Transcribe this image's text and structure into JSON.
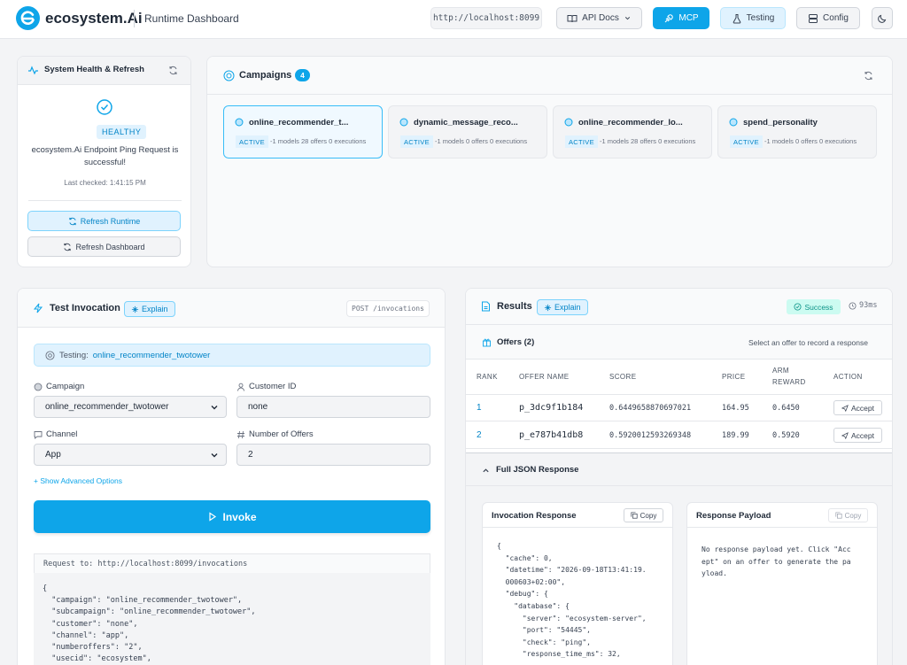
{
  "header": {
    "brand": "ecosystem.Ai",
    "subtitle": "Runtime Dashboard",
    "url": "http://localhost:8099",
    "api_docs": "API Docs",
    "mcp": "MCP",
    "testing": "Testing",
    "config": "Config"
  },
  "health": {
    "title": "System Health & Refresh",
    "status": "HEALTHY",
    "message": "ecosystem.Ai Endpoint Ping Request is successful!",
    "last_checked": "Last checked: 1:41:15 PM",
    "refresh_runtime": "Refresh Runtime",
    "refresh_dashboard": "Refresh Dashboard"
  },
  "campaigns": {
    "title": "Campaigns",
    "count": "4",
    "items": [
      {
        "name": "online_recommender_t...",
        "status": "ACTIVE",
        "meta": "-1 models 28 offers 0 executions"
      },
      {
        "name": "dynamic_message_reco...",
        "status": "ACTIVE",
        "meta": "-1 models 0 offers 0 executions"
      },
      {
        "name": "online_recommender_lo...",
        "status": "ACTIVE",
        "meta": "-1 models 28 offers 0 executions"
      },
      {
        "name": "spend_personality",
        "status": "ACTIVE",
        "meta": "-1 models 0 offers 0 executions"
      }
    ]
  },
  "test_invocation": {
    "title": "Test Invocation",
    "explain": "Explain",
    "endpoint": "POST /invocations",
    "testing_label": "Testing:",
    "testing_value": "online_recommender_twotower",
    "campaign_label": "Campaign",
    "campaign_value": "online_recommender_twotower",
    "customer_label": "Customer ID",
    "customer_value": "none",
    "channel_label": "Channel",
    "channel_value": "App",
    "offers_label": "Number of Offers",
    "offers_value": "2",
    "advanced": "+ Show Advanced Options",
    "invoke": "Invoke",
    "request_to": "Request to: http://localhost:8099/invocations",
    "request_body": "{\n  \"campaign\": \"online_recommender_twotower\",\n  \"subcampaign\": \"online_recommender_twotower\",\n  \"customer\": \"none\",\n  \"channel\": \"app\",\n  \"numberoffers\": \"2\",\n  \"usecid\": \"ecosystem\","
  },
  "results": {
    "title": "Results",
    "explain": "Explain",
    "status": "Success",
    "duration": "93ms",
    "offers_title": "Offers (2)",
    "offers_hint": "Select an offer to record a response",
    "columns": {
      "rank": "RANK",
      "offer_name": "OFFER NAME",
      "score": "SCORE",
      "price": "PRICE",
      "arm_reward_1": "ARM",
      "arm_reward_2": "REWARD",
      "action": "ACTION"
    },
    "rows": [
      {
        "rank": "1",
        "offer": "p_3dc9f1b184",
        "score": "0.6449658870697021",
        "price": "164.95",
        "arm": "0.6450",
        "action": "Accept"
      },
      {
        "rank": "2",
        "offer": "p_e787b41db8",
        "score": "0.5920012593269348",
        "price": "189.99",
        "arm": "0.5920",
        "action": "Accept"
      }
    ],
    "json_title": "Full JSON Response",
    "invocation_response_title": "Invocation Response",
    "copy": "Copy",
    "invocation_response": "{\n  \"cache\": 0,\n  \"datetime\": \"2026-09-18T13:41:19.\n  000603+02:00\",\n  \"debug\": {\n    \"database\": {\n      \"server\": \"ecosystem-server\",\n      \"port\": \"54445\",\n      \"check\": \"ping\",\n      \"response_time_ms\": 32,",
    "payload_title": "Response Payload",
    "payload_text": "No response payload yet. Click \"Acc\nept\" on an offer to generate the pa\nyload."
  },
  "colors": {
    "accent": "#0ea5e9",
    "accent_light": "#e0f2fe",
    "success": "#0d9488"
  }
}
